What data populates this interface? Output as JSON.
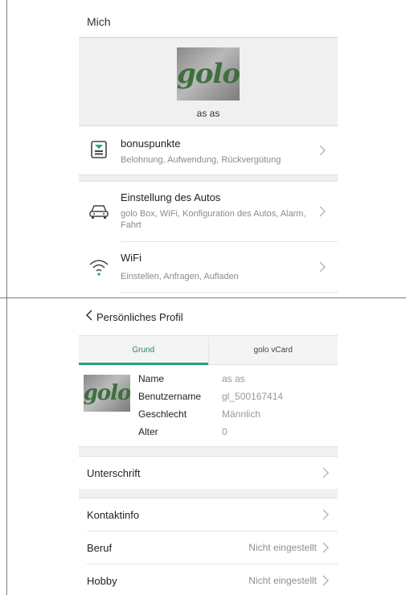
{
  "screen1": {
    "title": "Mich",
    "avatar_logo": "golo",
    "profile_name": "as as",
    "items": [
      {
        "title": "bonuspunkte",
        "subtitle": "Belohnung, Aufwendung, Rückvergütung",
        "icon": "coin-stack-icon"
      },
      {
        "title": "Einstellung des Autos",
        "subtitle": "golo Box, WiFi, Konfiguration des Autos, Alarm, Fahrt",
        "icon": "car-icon"
      },
      {
        "title": "WiFi",
        "subtitle": "Einstellen, Anfragen, Aufladen",
        "icon": "wifi-icon"
      }
    ]
  },
  "screen2": {
    "title": "Persönliches Profil",
    "tabs": [
      {
        "label": "Grund",
        "active": true
      },
      {
        "label": "golo vCard",
        "active": false
      }
    ],
    "avatar_logo": "golo",
    "info": [
      {
        "key": "Name",
        "value": "as as"
      },
      {
        "key": "Benutzername",
        "value": "gl_500167414"
      },
      {
        "key": "Geschlecht",
        "value": "Männlich"
      },
      {
        "key": "Alter",
        "value": "0"
      }
    ],
    "rows": {
      "signature": {
        "label": "Unterschrift",
        "value": ""
      },
      "contact": {
        "label": "Kontaktinfo",
        "value": ""
      },
      "job": {
        "label": "Beruf",
        "value": "Nicht eingestellt"
      },
      "hobby": {
        "label": "Hobby",
        "value": "Nicht eingestellt"
      }
    }
  },
  "colors": {
    "accent": "#1ea57a",
    "divider": "#e4e4e4",
    "muted": "#8a8a8a"
  }
}
